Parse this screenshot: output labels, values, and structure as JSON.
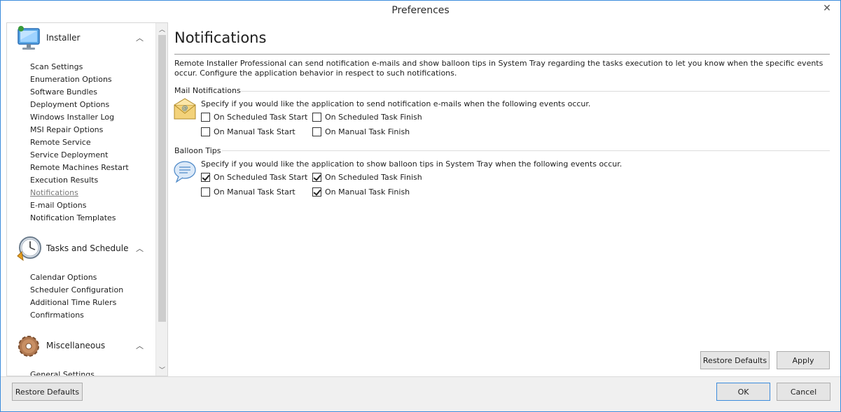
{
  "window": {
    "title": "Preferences",
    "close_glyph": "✕"
  },
  "sidebar": {
    "groups": [
      {
        "label": "Installer",
        "icon": "monitor-icon",
        "items": [
          "Scan Settings",
          "Enumeration Options",
          "Software Bundles",
          "Deployment Options",
          "Windows Installer Log",
          "MSI Repair Options",
          "Remote Service",
          "Service Deployment",
          "Remote Machines Restart",
          "Execution Results",
          "Notifications",
          "E-mail Options",
          "Notification Templates"
        ]
      },
      {
        "label": "Tasks and Schedule",
        "icon": "clock-icon",
        "items": [
          "Calendar Options",
          "Scheduler Configuration",
          "Additional Time Rulers",
          "Confirmations"
        ]
      },
      {
        "label": "Miscellaneous",
        "icon": "gear-icon",
        "items": [
          "General Settings"
        ]
      }
    ],
    "active_item": "Notifications",
    "chevron_glyph": "︿"
  },
  "content": {
    "heading": "Notifications",
    "description": "Remote Installer Professional can send notification e-mails and show balloon tips in System Tray regarding the tasks execution to let you know when the specific events occur. Configure the application behavior in respect to such notifications.",
    "mail": {
      "title": "Mail Notifications",
      "icon": "envelope-icon",
      "text": "Specify if you would like the application to send notification e-mails when the following events occur.",
      "options": [
        {
          "label": "On Scheduled Task Start",
          "checked": false
        },
        {
          "label": "On Scheduled Task Finish",
          "checked": false
        },
        {
          "label": "On Manual Task Start",
          "checked": false
        },
        {
          "label": "On Manual Task Finish",
          "checked": false
        }
      ]
    },
    "balloon": {
      "title": "Balloon Tips",
      "icon": "speech-bubble-icon",
      "text": "Specify if you would like the application to show balloon tips in System Tray when the following events occur.",
      "options": [
        {
          "label": "On Scheduled Task Start",
          "checked": true
        },
        {
          "label": "On Scheduled Task Finish",
          "checked": true
        },
        {
          "label": "On Manual Task Start",
          "checked": false
        },
        {
          "label": "On Manual Task Finish",
          "checked": true
        }
      ]
    },
    "restore_defaults": "Restore Defaults",
    "apply": "Apply"
  },
  "footer": {
    "restore_defaults": "Restore Defaults",
    "ok": "OK",
    "cancel": "Cancel"
  },
  "colors": {
    "accent": "#3c8cdc",
    "button_bg": "#e5e5e5",
    "footer_bg": "#f0f0f0"
  }
}
